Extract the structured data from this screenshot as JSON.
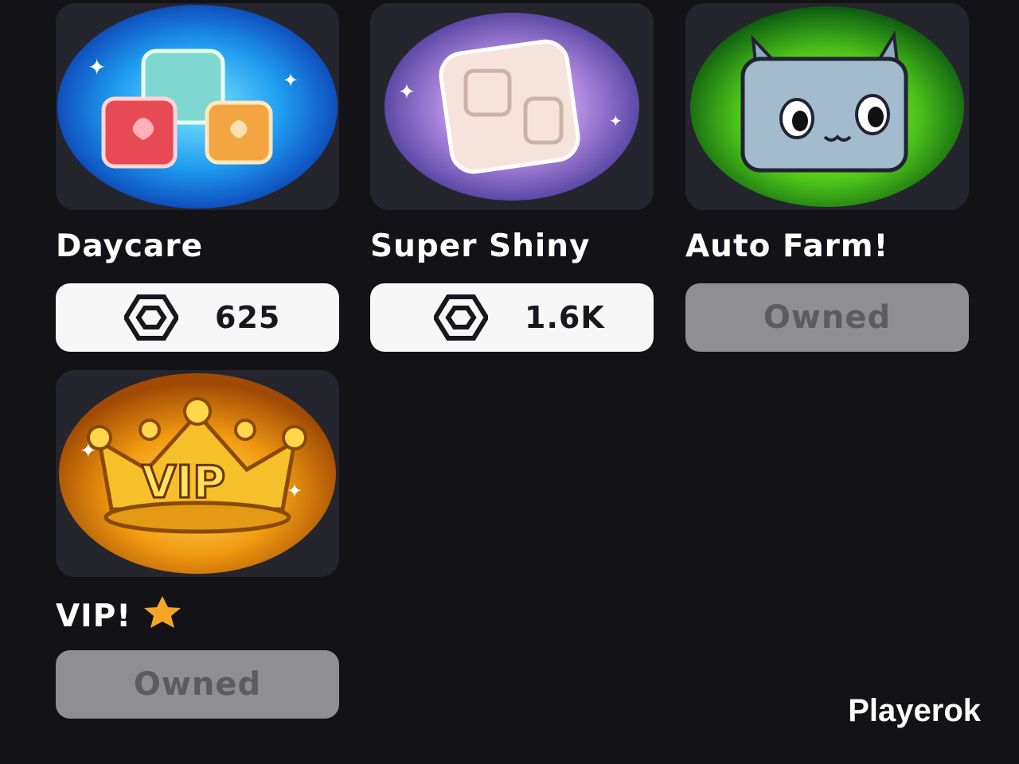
{
  "items": [
    {
      "title": "Daycare",
      "price": "625",
      "status": "buy",
      "image": "daycare-cubes-icon"
    },
    {
      "title": "Super Shiny",
      "price": "1.6K",
      "status": "buy",
      "image": "shiny-cube-icon"
    },
    {
      "title": "Auto Farm!",
      "button": "Owned",
      "status": "owned",
      "image": "cat-pet-icon"
    },
    {
      "title": "VIP!",
      "button": "Owned",
      "status": "owned",
      "image": "vip-crown-icon",
      "badge": "star-icon"
    }
  ],
  "watermark": "Playerok",
  "colors": {
    "background": "#121217",
    "card": "#25252d",
    "price_button": "#f7f7f8",
    "owned_button": "#8e8e93",
    "star": "#f5a623"
  }
}
